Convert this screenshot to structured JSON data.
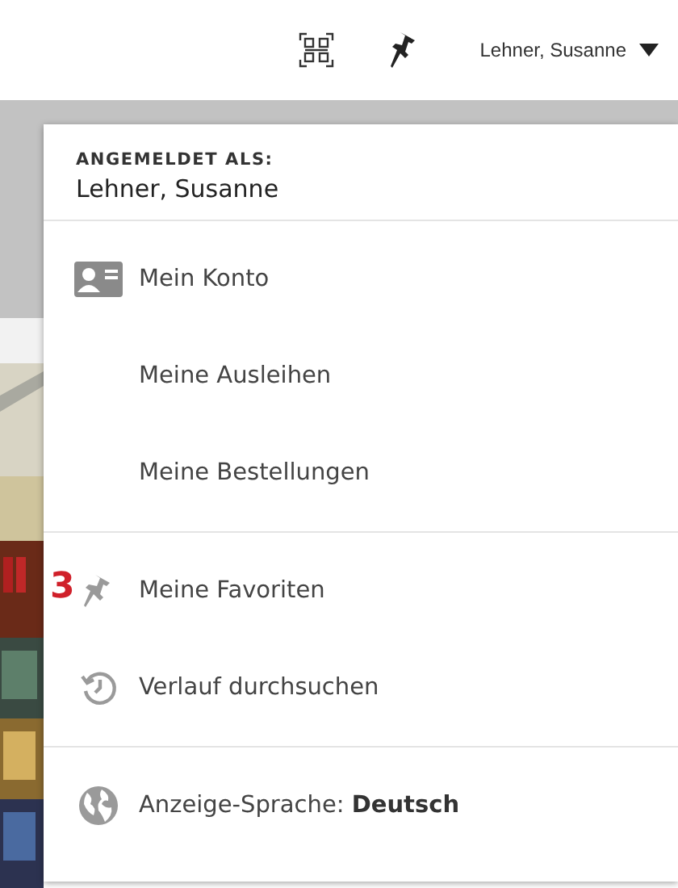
{
  "top_bar": {
    "user_menu": {
      "label": "Lehner, Susanne",
      "expanded": true
    }
  },
  "account_menu": {
    "header_label": "ANGEMELDET ALS:",
    "user_name": "Lehner, Susanne",
    "groups": [
      [
        {
          "kind": "account",
          "label": "Mein Konto"
        },
        {
          "kind": "plain",
          "label": "Meine Ausleihen"
        },
        {
          "kind": "plain",
          "label": "Meine Bestellungen"
        }
      ],
      [
        {
          "kind": "favorites",
          "label": "Meine Favoriten",
          "annotation": "3"
        },
        {
          "kind": "history",
          "label": "Verlauf durchsuchen"
        }
      ],
      [
        {
          "kind": "language",
          "label": "Anzeige-Sprache: **Deutsch**"
        }
      ]
    ]
  }
}
